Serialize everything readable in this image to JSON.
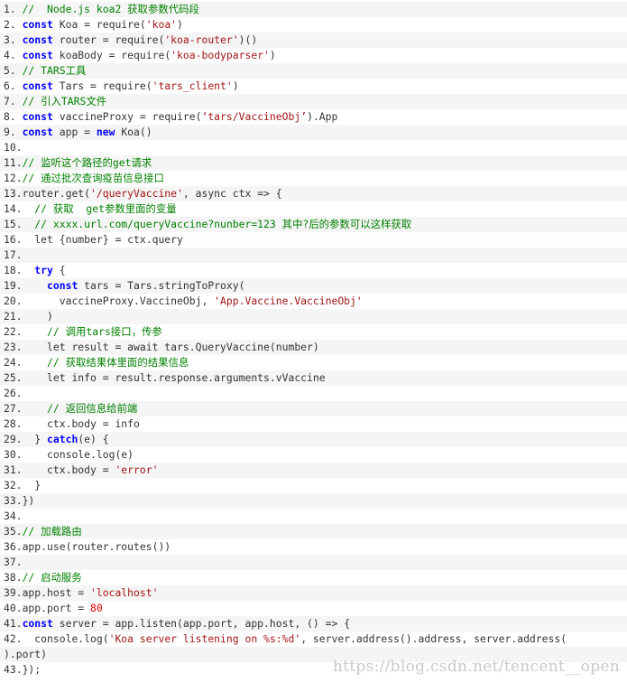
{
  "watermark": "https://blog.csdn.net/tencent__open",
  "colors": {
    "keyword": "#0000ff",
    "string": "#a31515",
    "comment": "#008000",
    "number": "#e00000",
    "text": "#333333",
    "stripe": "#f5f5f5"
  },
  "lines": [
    {
      "n": "1. ",
      "t": [
        [
          "comment",
          "//  Node.js koa2 获取参数代码段"
        ]
      ]
    },
    {
      "n": "2. ",
      "t": [
        [
          "keyword",
          "const"
        ],
        [
          "plain",
          " Koa = require("
        ],
        [
          "string",
          "'koa'"
        ],
        [
          "plain",
          ")"
        ]
      ]
    },
    {
      "n": "3. ",
      "t": [
        [
          "keyword",
          "const"
        ],
        [
          "plain",
          " router = require("
        ],
        [
          "string",
          "'koa-router'"
        ],
        [
          "plain",
          ")()"
        ]
      ]
    },
    {
      "n": "4. ",
      "t": [
        [
          "keyword",
          "const"
        ],
        [
          "plain",
          " koaBody = require("
        ],
        [
          "string",
          "'koa-bodyparser'"
        ],
        [
          "plain",
          ")"
        ]
      ]
    },
    {
      "n": "5. ",
      "t": [
        [
          "comment",
          "// TARS工具"
        ]
      ]
    },
    {
      "n": "6. ",
      "t": [
        [
          "keyword",
          "const"
        ],
        [
          "plain",
          " Tars = require("
        ],
        [
          "string",
          "'tars_client'"
        ],
        [
          "plain",
          ")"
        ]
      ]
    },
    {
      "n": "7. ",
      "t": [
        [
          "comment",
          "// 引入TARS文件"
        ]
      ]
    },
    {
      "n": "8. ",
      "t": [
        [
          "keyword",
          "const"
        ],
        [
          "plain",
          " vaccineProxy = require("
        ],
        [
          "string",
          "‘tars/VaccineObj’"
        ],
        [
          "plain",
          ").App"
        ]
      ]
    },
    {
      "n": "9. ",
      "t": [
        [
          "keyword",
          "const"
        ],
        [
          "plain",
          " app = "
        ],
        [
          "keyword",
          "new"
        ],
        [
          "plain",
          " Koa()"
        ]
      ]
    },
    {
      "n": "10.",
      "t": []
    },
    {
      "n": "11.",
      "t": [
        [
          "comment",
          "// 监听这个路径的get请求"
        ]
      ]
    },
    {
      "n": "12.",
      "t": [
        [
          "comment",
          "// 通过批次查询疫苗信息接口"
        ]
      ]
    },
    {
      "n": "13.",
      "t": [
        [
          "plain",
          "router.get("
        ],
        [
          "string",
          "'/queryVaccine'"
        ],
        [
          "plain",
          ", async ctx => {"
        ]
      ]
    },
    {
      "n": "14.",
      "t": [
        [
          "plain",
          "  "
        ],
        [
          "comment",
          "// 获取  get参数里面的变量"
        ]
      ]
    },
    {
      "n": "15.",
      "t": [
        [
          "plain",
          "  "
        ],
        [
          "comment",
          "// xxxx.url.com/queryVaccine?nunber=123 其中?后的参数可以这样获取"
        ]
      ]
    },
    {
      "n": "16.",
      "t": [
        [
          "plain",
          "  let {number} = ctx.query"
        ]
      ]
    },
    {
      "n": "17.",
      "t": []
    },
    {
      "n": "18.",
      "t": [
        [
          "plain",
          "  "
        ],
        [
          "keyword",
          "try"
        ],
        [
          "plain",
          " {"
        ]
      ]
    },
    {
      "n": "19.",
      "t": [
        [
          "plain",
          "    "
        ],
        [
          "keyword",
          "const"
        ],
        [
          "plain",
          " tars = Tars.stringToProxy("
        ]
      ]
    },
    {
      "n": "20.",
      "t": [
        [
          "plain",
          "      vaccineProxy.VaccineObj, "
        ],
        [
          "string",
          "'App.Vaccine.VaccineObj'"
        ]
      ]
    },
    {
      "n": "21.",
      "t": [
        [
          "plain",
          "    )"
        ]
      ]
    },
    {
      "n": "22.",
      "t": [
        [
          "plain",
          "    "
        ],
        [
          "comment",
          "// 调用tars接口，传参"
        ]
      ]
    },
    {
      "n": "23.",
      "t": [
        [
          "plain",
          "    let result = await tars.QueryVaccine(number)"
        ]
      ]
    },
    {
      "n": "24.",
      "t": [
        [
          "plain",
          "    "
        ],
        [
          "comment",
          "// 获取结果体里面的结果信息"
        ]
      ]
    },
    {
      "n": "25.",
      "t": [
        [
          "plain",
          "    let info = result.response.arguments.vVaccine"
        ]
      ]
    },
    {
      "n": "26.",
      "t": []
    },
    {
      "n": "27.",
      "t": [
        [
          "plain",
          "    "
        ],
        [
          "comment",
          "// 返回信息给前端"
        ]
      ]
    },
    {
      "n": "28.",
      "t": [
        [
          "plain",
          "    ctx.body = info"
        ]
      ]
    },
    {
      "n": "29.",
      "t": [
        [
          "plain",
          "  } "
        ],
        [
          "keyword",
          "catch"
        ],
        [
          "plain",
          "(e) {"
        ]
      ]
    },
    {
      "n": "30.",
      "t": [
        [
          "plain",
          "    console.log(e)"
        ]
      ]
    },
    {
      "n": "31.",
      "t": [
        [
          "plain",
          "    ctx.body = "
        ],
        [
          "string",
          "'error'"
        ]
      ]
    },
    {
      "n": "32.",
      "t": [
        [
          "plain",
          "  }"
        ]
      ]
    },
    {
      "n": "33.",
      "t": [
        [
          "plain",
          "})"
        ]
      ]
    },
    {
      "n": "34.",
      "t": []
    },
    {
      "n": "35.",
      "t": [
        [
          "comment",
          "// 加载路由"
        ]
      ]
    },
    {
      "n": "36.",
      "t": [
        [
          "plain",
          "app.use(router.routes())"
        ]
      ]
    },
    {
      "n": "37.",
      "t": []
    },
    {
      "n": "38.",
      "t": [
        [
          "comment",
          "// 启动服务"
        ]
      ]
    },
    {
      "n": "39.",
      "t": [
        [
          "plain",
          "app.host = "
        ],
        [
          "string",
          "'localhost'"
        ]
      ]
    },
    {
      "n": "40.",
      "t": [
        [
          "plain",
          "app.port = "
        ],
        [
          "number",
          "80"
        ]
      ]
    },
    {
      "n": "41.",
      "t": [
        [
          "keyword",
          "const"
        ],
        [
          "plain",
          " server = app.listen(app.port, app.host, () => {"
        ]
      ]
    },
    {
      "n": "42.",
      "t": [
        [
          "plain",
          "  console.log("
        ],
        [
          "string",
          "'Koa server listening on %s:%d'"
        ],
        [
          "plain",
          ", server.address().address, server.address("
        ]
      ]
    },
    {
      "n": "",
      "t": [
        [
          "plain",
          ").port)"
        ]
      ]
    },
    {
      "n": "43.",
      "t": [
        [
          "plain",
          "});"
        ]
      ]
    }
  ]
}
